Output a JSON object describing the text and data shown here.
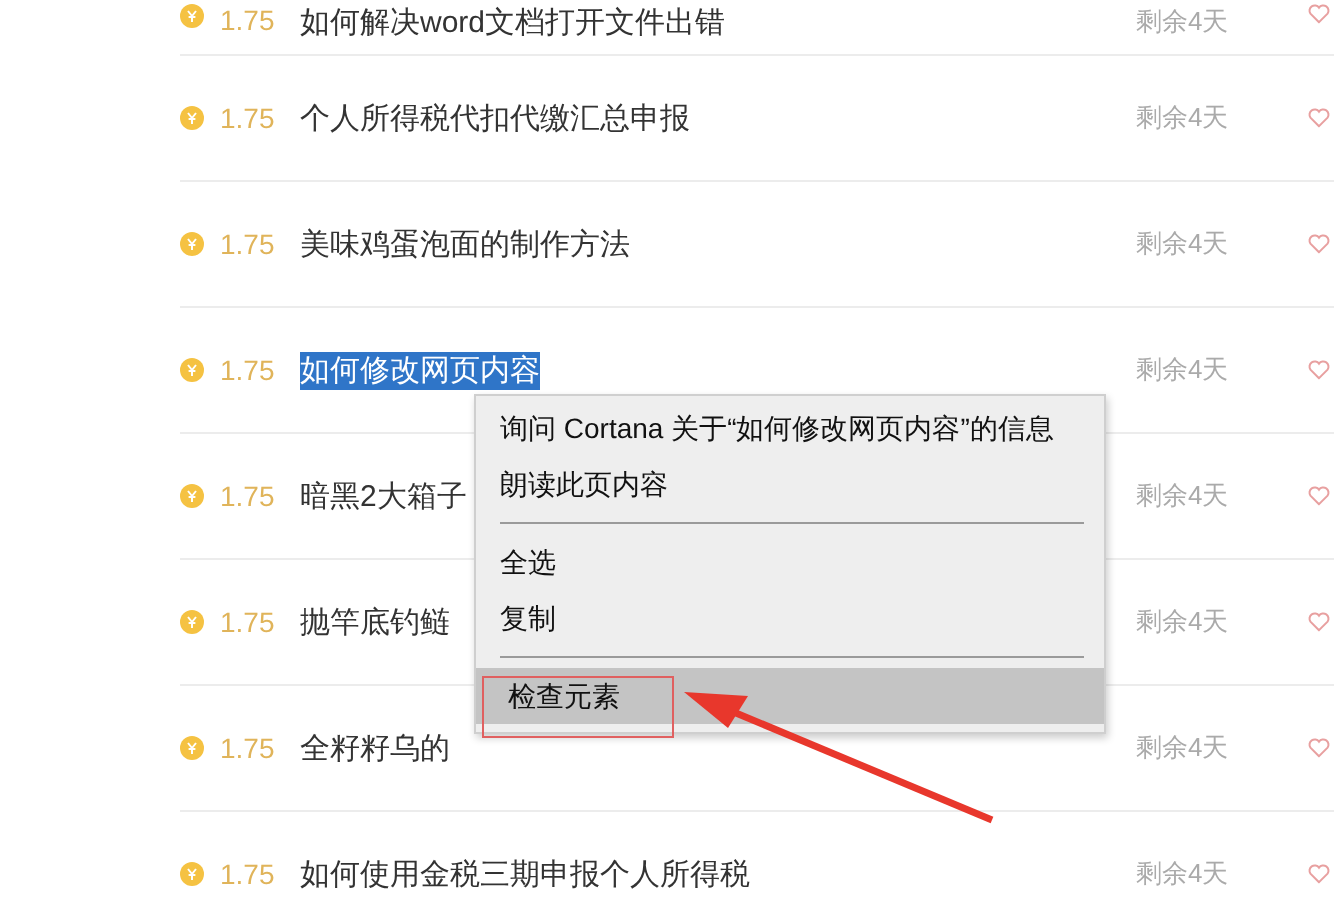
{
  "rows": [
    {
      "price": "1.75",
      "title": "如何解决word文档打开文件出错",
      "remaining": "剩余4天",
      "selected": false
    },
    {
      "price": "1.75",
      "title": "个人所得税代扣代缴汇总申报",
      "remaining": "剩余4天",
      "selected": false
    },
    {
      "price": "1.75",
      "title": "美味鸡蛋泡面的制作方法",
      "remaining": "剩余4天",
      "selected": false
    },
    {
      "price": "1.75",
      "title": "如何修改网页内容",
      "remaining": "剩余4天",
      "selected": true
    },
    {
      "price": "1.75",
      "title": "暗黑2大箱子",
      "remaining": "剩余4天",
      "selected": false
    },
    {
      "price": "1.75",
      "title": "抛竿底钓鲢",
      "remaining": "剩余4天",
      "selected": false
    },
    {
      "price": "1.75",
      "title": "全籽籽乌的",
      "remaining": "剩余4天",
      "selected": false
    },
    {
      "price": "1.75",
      "title": "如何使用金税三期申报个人所得税",
      "remaining": "剩余4天",
      "selected": false
    }
  ],
  "context_menu": {
    "groups": [
      [
        {
          "label": "询问 Cortana 关于“如何修改网页内容”的信息",
          "selected": false
        },
        {
          "label": "朗读此页内容",
          "selected": false
        }
      ],
      [
        {
          "label": "全选",
          "selected": false
        },
        {
          "label": "复制",
          "selected": false
        }
      ],
      [
        {
          "label": "检查元素",
          "selected": true
        }
      ]
    ]
  }
}
